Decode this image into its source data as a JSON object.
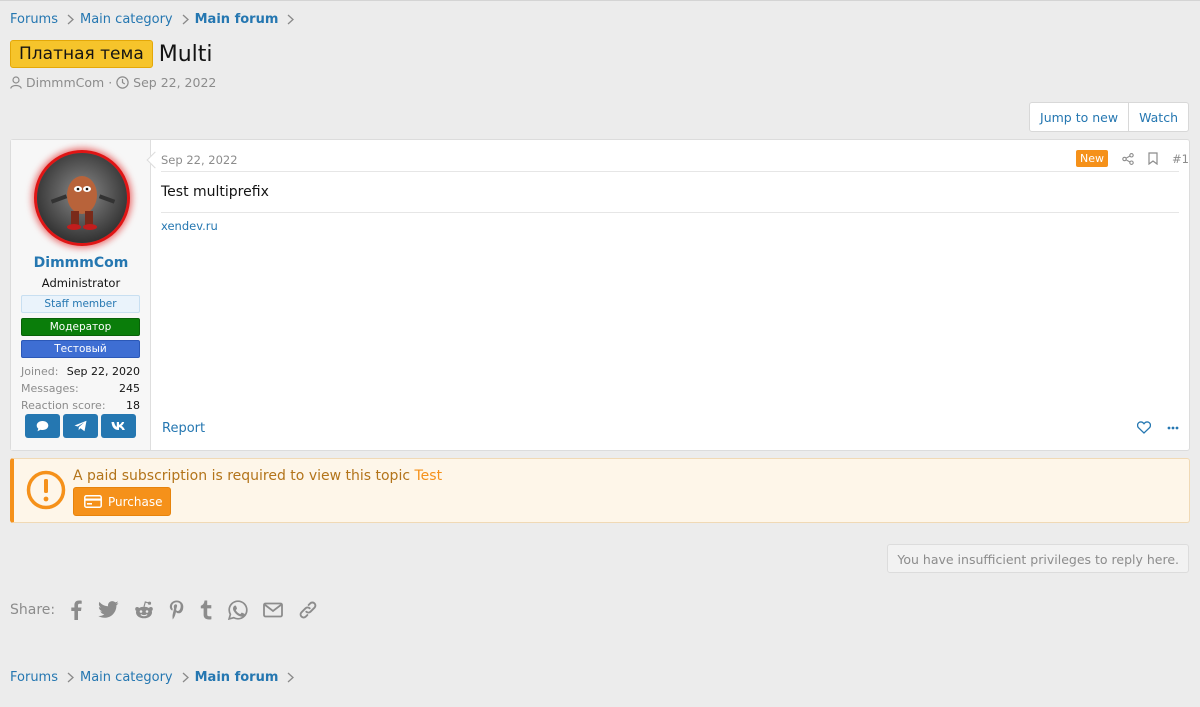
{
  "breadcrumbs": [
    "Forums",
    "Main category",
    "Main forum"
  ],
  "thread": {
    "prefix": "Платная тема",
    "title": "Multi",
    "author": "DimmmCom",
    "date": "Sep 22, 2022"
  },
  "actions": {
    "jump_to_new": "Jump to new",
    "watch": "Watch"
  },
  "post": {
    "date": "Sep 22, 2022",
    "new_badge": "New",
    "number": "#1",
    "body": "Test multiprefix",
    "signature": "xendev.ru",
    "report": "Report"
  },
  "user": {
    "name": "DimmmCom",
    "title": "Administrator",
    "banners": [
      "Staff member",
      "Модератор",
      "Тестовый"
    ],
    "stats": [
      {
        "key": "Joined:",
        "value": "Sep 22, 2020"
      },
      {
        "key": "Messages:",
        "value": "245"
      },
      {
        "key": "Reaction score:",
        "value": "18"
      }
    ]
  },
  "notice": {
    "text": "A paid subscription is required to view this topic",
    "link": "Test",
    "button": "Purchase"
  },
  "no_reply": "You have insufficient privileges to reply here.",
  "share": {
    "label": "Share:",
    "icons": [
      "facebook-icon",
      "twitter-icon",
      "reddit-icon",
      "pinterest-icon",
      "tumblr-icon",
      "whatsapp-icon",
      "email-icon",
      "link-icon"
    ]
  },
  "colors": {
    "link": "#2577b1",
    "prefix": "#f6c42b",
    "accent": "#f5911a",
    "moderator": "#0a7d0a",
    "test_banner": "#3e6ed3",
    "avatar_ring": "#e01515"
  }
}
